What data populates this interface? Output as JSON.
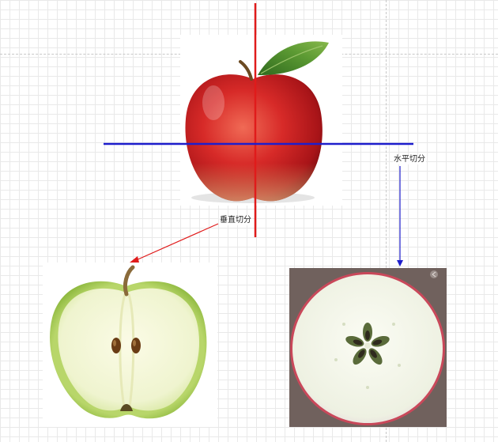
{
  "labels": {
    "vertical_cut": "垂直切分",
    "horizontal_cut": "水平切分"
  },
  "colors": {
    "vertical_axis": "#e01b1b",
    "horizontal_axis": "#1e1ecc",
    "grid": "#e9e9e9"
  },
  "images": {
    "whole_apple": "red-apple-photo",
    "vertical_half": "green-apple-vertical-half-photo",
    "horizontal_slice": "apple-horizontal-cross-section-photo"
  }
}
